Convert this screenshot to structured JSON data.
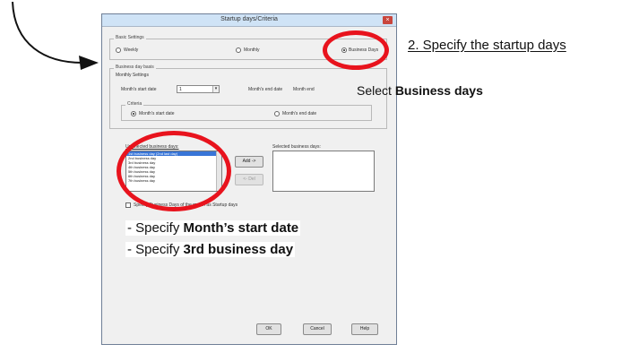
{
  "dialog": {
    "title": "Startup days/Criteria",
    "close_glyph": "×",
    "basic_settings": {
      "title": "Basic Settings",
      "options": [
        "Weekly",
        "Monthly",
        "Business Days"
      ],
      "selected": "Business Days"
    },
    "business_day_basis": {
      "title": "Business day basis",
      "monthly_settings": {
        "title": "Monthly Settings",
        "start_date_label": "Month's start date",
        "start_date_value": "1",
        "end_date_label": "Month's end date",
        "end_date_value": "Month end"
      },
      "criteria": {
        "title": "Criteria",
        "options": [
          "Month's start date",
          "Month's end date"
        ],
        "selected": "Month's start date"
      }
    },
    "unselected_label": "Unselected business days:",
    "selected_label": "Selected business days:",
    "unselected_items": [
      "1st business day (2nd last day)",
      "2nd business day",
      "3rd business day",
      "4th business day",
      "5th business day",
      "6th business day",
      "7th business day"
    ],
    "add_button": "Add ->",
    "remove_button": "<- Del",
    "specify_checkbox_label": "Specify Business Days of the month as Startup days",
    "ok_button": "OK",
    "cancel_button": "Cancel",
    "help_button": "Help"
  },
  "annotations": {
    "step2": "2. Specify the startup days",
    "select_prefix": "Select",
    "select_bold": "Business days",
    "bullet1_prefix": "- Specify",
    "bullet1_bold": "Month’s start date",
    "bullet2_prefix": "- Specify",
    "bullet2_bold": "3rd business day",
    "accent_color": "#e8131d"
  }
}
